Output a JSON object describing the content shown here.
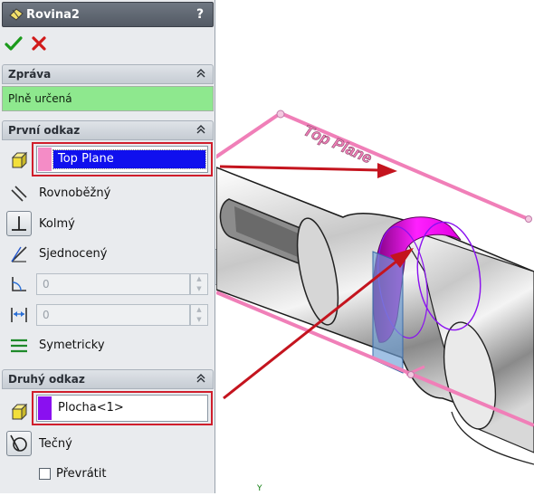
{
  "header": {
    "title": "Rovina2",
    "help": "?"
  },
  "actions": {
    "ok": "✔",
    "cancel": "✖"
  },
  "message_group": {
    "title": "Zpráva",
    "text": "Plně určená"
  },
  "first_reference": {
    "title": "První odkaz",
    "selection": "Top Plane",
    "options": {
      "parallel": "Rovnoběžný",
      "perpendicular": "Kolmý",
      "coincident": "Sjednocený",
      "symmetric": "Symetricky"
    },
    "angle_value": "0",
    "distance_value": "0"
  },
  "second_reference": {
    "title": "Druhý odkaz",
    "selection": "Plocha<1>",
    "tangent": "Tečný",
    "flip": "Převrátit"
  },
  "viewport": {
    "plane_label": "Top Plane",
    "axis_label": "Y"
  },
  "colors": {
    "header": "#5d6570",
    "message_ok": "#8ee88e",
    "selection_highlight": "#1010ee",
    "plane_pink": "#f07fb8",
    "face_magenta": "#e000e0",
    "arrow_red": "#c4141e",
    "swatch_first": "#f48cc6",
    "swatch_second": "#8a10f0"
  },
  "icons": [
    "feature-plane-icon",
    "help-icon",
    "ok-icon",
    "cancel-icon",
    "collapse-icon",
    "face-selection-icon",
    "parallel-icon",
    "perpendicular-icon",
    "coincident-icon",
    "angle-icon",
    "distance-icon",
    "symmetric-icon",
    "tangent-icon"
  ]
}
